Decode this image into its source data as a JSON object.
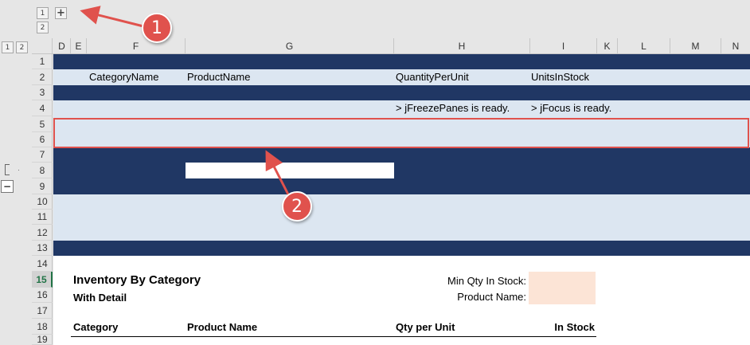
{
  "outline_levels": {
    "row_levels": [
      "1",
      "2"
    ],
    "column_levels": [
      "1",
      "2"
    ],
    "expand_label": "+",
    "collapse_label": "−"
  },
  "columns": [
    "D",
    "E",
    "F",
    "G",
    "H",
    "I",
    "K",
    "L",
    "M",
    "N"
  ],
  "rows": [
    "1",
    "2",
    "3",
    "4",
    "5",
    "6",
    "7",
    "8",
    "9",
    "10",
    "11",
    "12",
    "13",
    "14",
    "15",
    "16",
    "17",
    "18",
    "19"
  ],
  "active_row": "15",
  "header_row": {
    "category_name": "CategoryName",
    "product_name": "ProductName",
    "quantity_per_unit": "QuantityPerUnit",
    "units_in_stock": "UnitsInStock"
  },
  "status_row": {
    "freeze_panes": "> jFreezePanes is ready.",
    "focus": "> jFocus is ready."
  },
  "report": {
    "title": "Inventory By Category",
    "subtitle": "With Detail",
    "min_qty_label": "Min Qty In Stock:",
    "product_name_label": "Product Name:",
    "min_qty_value": "",
    "product_name_value": "",
    "col_category": "Category",
    "col_product": "Product Name",
    "col_qty": "Qty per Unit",
    "col_stock": "In Stock"
  },
  "annotations": [
    "1",
    "2"
  ],
  "colors": {
    "navy_band": "#203764",
    "light_band": "#dce6f1",
    "highlight": "#e0524d",
    "input_fill": "#fce4d6"
  }
}
